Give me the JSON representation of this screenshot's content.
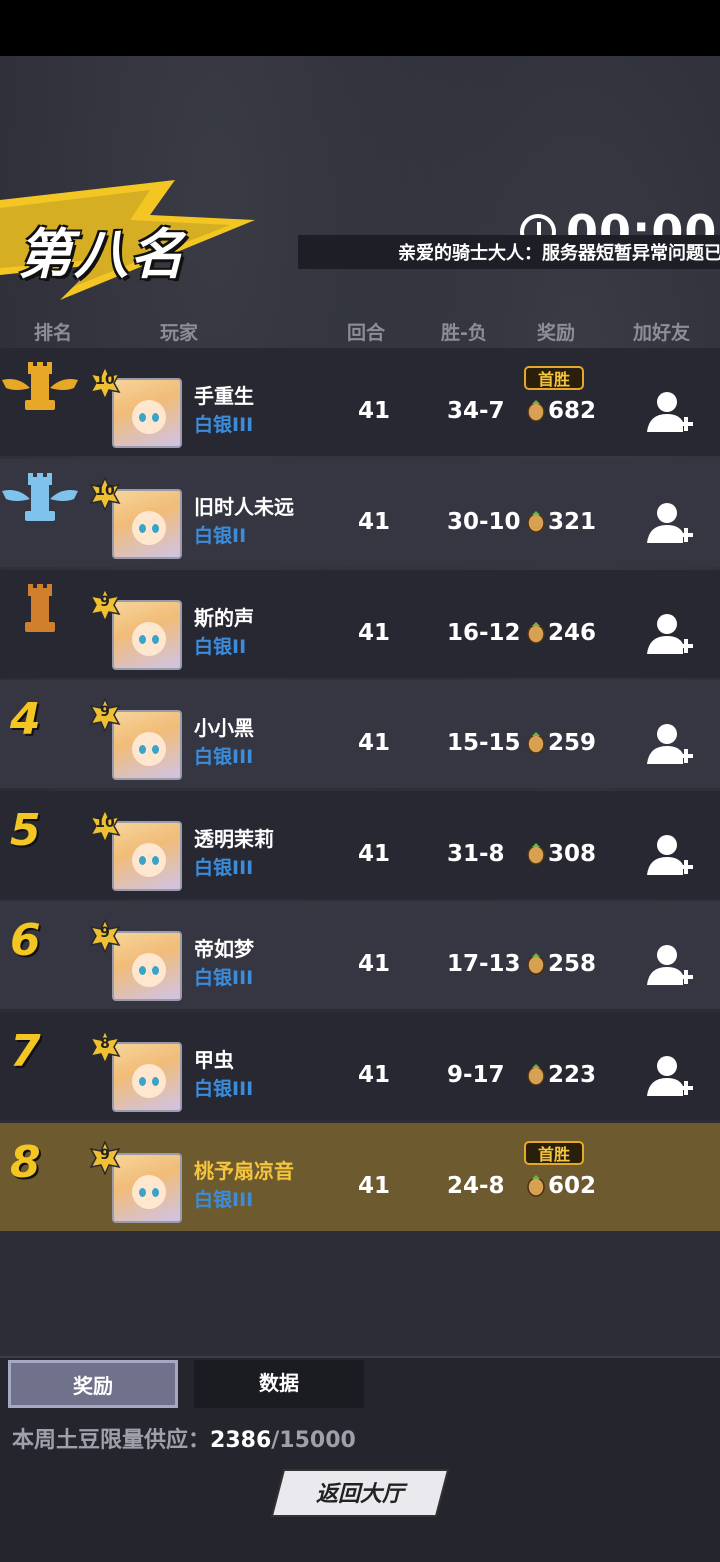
{
  "header": {
    "title": "第八名",
    "timer": "00:00",
    "notice": "亲爱的骑士大人：服务器短暂异常问题已"
  },
  "columns": {
    "rank": "排名",
    "player": "玩家",
    "rounds": "回合",
    "winloss": "胜-负",
    "reward": "奖励",
    "addfriend": "加好友"
  },
  "rows": [
    {
      "rank": "1",
      "level": "10",
      "name": "手重生",
      "tier": "白银III",
      "rounds": "41",
      "wl": "34-7",
      "reward": "682",
      "badge": "首胜"
    },
    {
      "rank": "2",
      "level": "10",
      "name": "旧时人未远",
      "tier": "白银II",
      "rounds": "41",
      "wl": "30-10",
      "reward": "321",
      "badge": ""
    },
    {
      "rank": "3",
      "level": "9",
      "name": "斯的声",
      "tier": "白银II",
      "rounds": "41",
      "wl": "16-12",
      "reward": "246",
      "badge": ""
    },
    {
      "rank": "4",
      "level": "9",
      "name": "小小黑",
      "tier": "白银III",
      "rounds": "41",
      "wl": "15-15",
      "reward": "259",
      "badge": ""
    },
    {
      "rank": "5",
      "level": "10",
      "name": "透明茉莉",
      "tier": "白银III",
      "rounds": "41",
      "wl": "31-8",
      "reward": "308",
      "badge": ""
    },
    {
      "rank": "6",
      "level": "9",
      "name": "帝如梦",
      "tier": "白银III",
      "rounds": "41",
      "wl": "17-13",
      "reward": "258",
      "badge": ""
    },
    {
      "rank": "7",
      "level": "8",
      "name": "甲虫",
      "tier": "白银III",
      "rounds": "41",
      "wl": "9-17",
      "reward": "223",
      "badge": ""
    },
    {
      "rank": "8",
      "level": "9",
      "name": "桃予扇凉音",
      "tier": "白银III",
      "rounds": "41",
      "wl": "24-8",
      "reward": "602",
      "badge": "首胜"
    }
  ],
  "tabs": {
    "reward": "奖励",
    "stats": "数据"
  },
  "supply": {
    "label": "本周土豆限量供应：",
    "current": "2386",
    "total": "/15000"
  },
  "back_button": "返回大厅",
  "colors": {
    "accent": "#f4c623",
    "tier_blue": "#3b8ddc",
    "highlight_row": "#6e5a2f"
  }
}
